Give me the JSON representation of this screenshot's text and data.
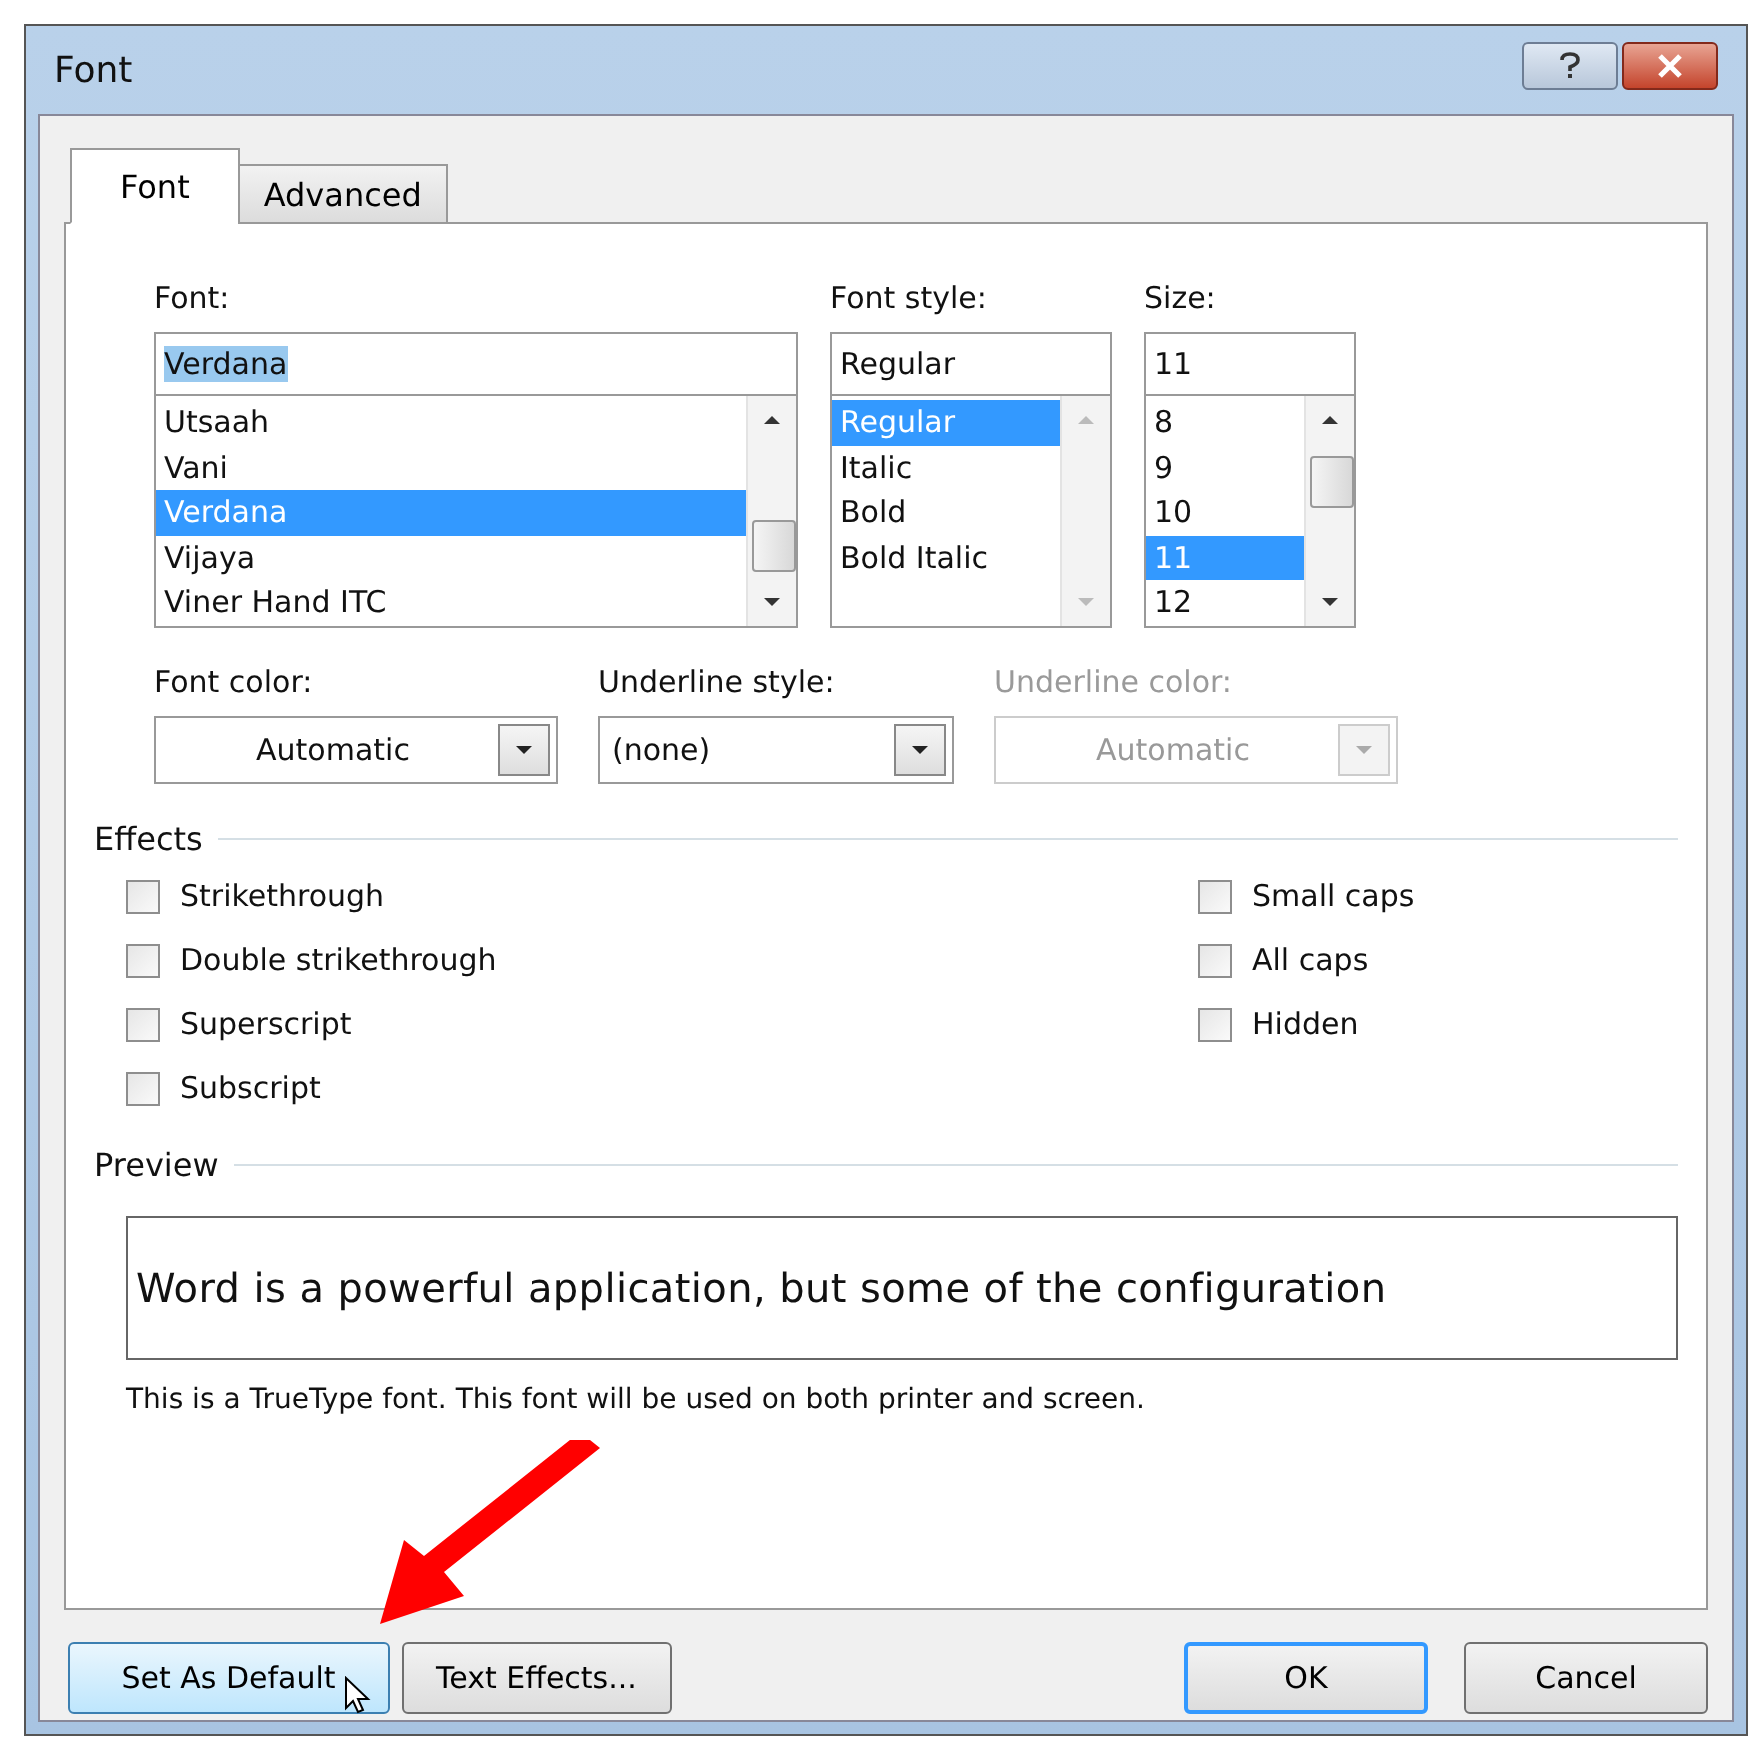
{
  "window": {
    "title": "Font"
  },
  "tabs": [
    {
      "label": "Font",
      "selected": true
    },
    {
      "label": "Advanced",
      "selected": false
    }
  ],
  "lists": [
    {
      "label": "Font:",
      "value": "Verdana",
      "value_selected": true,
      "items": [
        {
          "label": "Utsaah",
          "selected": false
        },
        {
          "label": "Vani",
          "selected": false
        },
        {
          "label": "Verdana",
          "selected": true
        },
        {
          "label": "Vijaya",
          "selected": false
        },
        {
          "label": "Viner Hand ITC",
          "selected": false
        }
      ]
    },
    {
      "label": "Font style:",
      "value": "Regular",
      "value_selected": false,
      "items": [
        {
          "label": "Regular",
          "selected": true
        },
        {
          "label": "Italic",
          "selected": false
        },
        {
          "label": "Bold",
          "selected": false
        },
        {
          "label": "Bold Italic",
          "selected": false
        }
      ]
    },
    {
      "label": "Size:",
      "value": "11",
      "value_selected": false,
      "items": [
        {
          "label": "8",
          "selected": false
        },
        {
          "label": "9",
          "selected": false
        },
        {
          "label": "10",
          "selected": false
        },
        {
          "label": "11",
          "selected": true
        },
        {
          "label": "12",
          "selected": false
        }
      ]
    }
  ],
  "dropdowns": [
    {
      "label": "Font color:",
      "value": "Automatic",
      "disabled": false
    },
    {
      "label": "Underline style:",
      "value": "(none)",
      "disabled": false
    },
    {
      "label": "Underline color:",
      "value": "Automatic",
      "disabled": true
    }
  ],
  "effects": {
    "title": "Effects",
    "columns": [
      [
        {
          "label": "Strikethrough",
          "checked": false
        },
        {
          "label": "Double strikethrough",
          "checked": false
        },
        {
          "label": "Superscript",
          "checked": false
        },
        {
          "label": "Subscript",
          "checked": false
        }
      ],
      [
        {
          "label": "Small caps",
          "checked": false
        },
        {
          "label": "All caps",
          "checked": false
        },
        {
          "label": "Hidden",
          "checked": false
        }
      ]
    ]
  },
  "preview": {
    "title": "Preview",
    "sample": "Word is a powerful application, but some of the configuration",
    "note": "This is a TrueType font. This font will be used on both printer and screen."
  },
  "buttons": [
    {
      "label": "Set As Default",
      "focused": false,
      "hovered": true
    },
    {
      "label": "Text Effects...",
      "focused": false,
      "hovered": false
    },
    {
      "label": "OK",
      "focused": true,
      "hovered": false
    },
    {
      "label": "Cancel",
      "focused": false,
      "hovered": false
    }
  ]
}
